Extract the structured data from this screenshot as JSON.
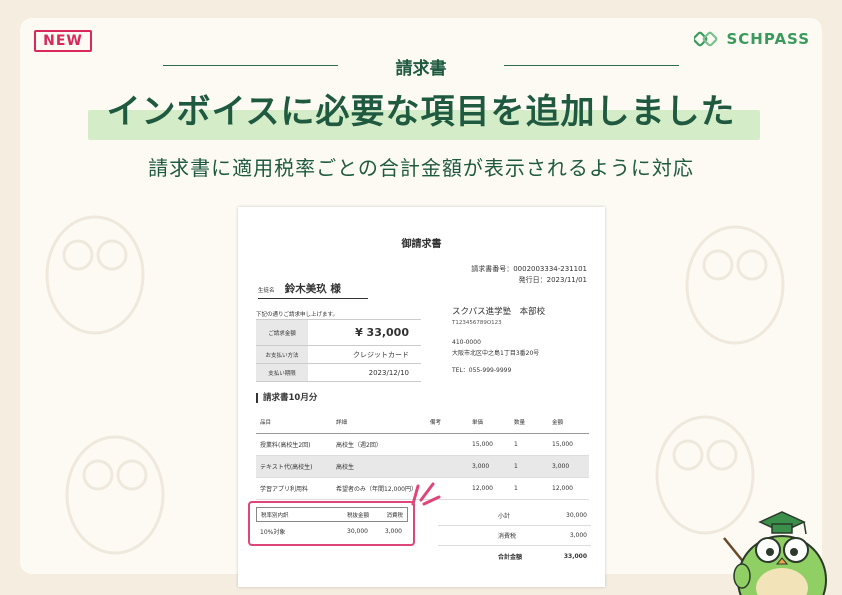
{
  "badge": "NEW",
  "logo": {
    "text": "SCHPASS"
  },
  "section_label": "請求書",
  "headline": "インボイスに必要な項目を追加しました",
  "subheadline": "請求書に適用税率ごとの合計金額が表示されるように対応",
  "colors": {
    "accent_green": "#1f5a40",
    "highlight_pink": "#e0457a",
    "headline_bg": "#d5ecc8"
  },
  "invoice": {
    "title": "御請求書",
    "number_line": "請求書番号：0002003334-231101",
    "date_line": "発行日：2023/11/01",
    "student_label": "生徒名",
    "student_name": "鈴木美玖 様",
    "request_note": "下記の通りご請求申し上げます。",
    "payment": [
      {
        "key": "ご請求金額",
        "value": "¥ 33,000"
      },
      {
        "key": "お支払い方法",
        "value": "クレジットカード"
      },
      {
        "key": "支払い期限",
        "value": "2023/12/10"
      }
    ],
    "school": {
      "name": "スクパス進学塾　本部校",
      "reg_no": "T123456789O123",
      "postal": "410-0000",
      "address": "大阪市北区中之島1丁目3番20号",
      "tel": "TEL：055-999-9999"
    },
    "section_heading": "請求書10月分",
    "columns": [
      "品目",
      "詳細",
      "備考",
      "単価",
      "数量",
      "金額"
    ],
    "rows": [
      {
        "item": "授業料(高校生2回)",
        "detail": "高校生（週2回）",
        "note": "",
        "price": "15,000",
        "qty": "1",
        "amount": "15,000"
      },
      {
        "item": "テキスト代(高校生)",
        "detail": "高校生",
        "note": "",
        "price": "3,000",
        "qty": "1",
        "amount": "3,000"
      },
      {
        "item": "学習アプリ利用料",
        "detail": "希望者のみ（年間12,000円）",
        "note": "",
        "price": "12,000",
        "qty": "1",
        "amount": "12,000"
      }
    ],
    "tax_breakdown": {
      "headers": [
        "税率別内訳",
        "税抜金額",
        "消費税"
      ],
      "row": [
        "10%対象",
        "30,000",
        "3,000"
      ]
    },
    "totals": [
      {
        "label": "小計",
        "value": "30,000"
      },
      {
        "label": "消費税",
        "value": "3,000"
      },
      {
        "label": "合計金額",
        "value": "33,000"
      }
    ]
  }
}
